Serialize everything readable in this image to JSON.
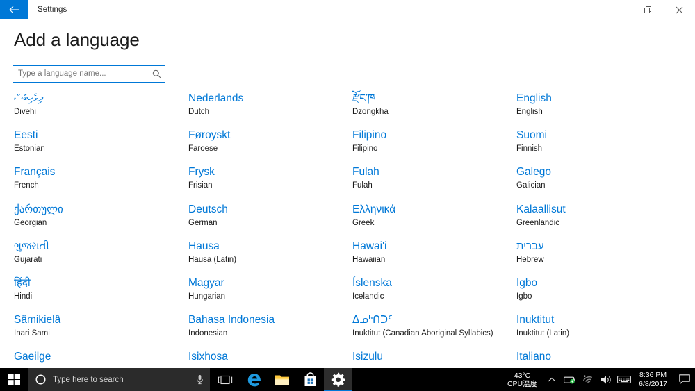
{
  "window": {
    "title": "Settings",
    "back_icon": "back-arrow-icon",
    "minimize_label": "Minimize",
    "restore_label": "Restore",
    "close_label": "Close"
  },
  "page": {
    "heading": "Add a language"
  },
  "search": {
    "placeholder": "Type a language name...",
    "value": "",
    "icon": "search-icon"
  },
  "languages": [
    [
      {
        "native": "ދިވެހިބަސް",
        "english": "Divehi",
        "script": true
      },
      {
        "native": "Nederlands",
        "english": "Dutch",
        "script": false
      },
      {
        "native": "རྫོང་ཁ",
        "english": "Dzongkha",
        "script": true
      },
      {
        "native": "English",
        "english": "English",
        "script": false
      }
    ],
    [
      {
        "native": "Eesti",
        "english": "Estonian",
        "script": false
      },
      {
        "native": "Føroyskt",
        "english": "Faroese",
        "script": false
      },
      {
        "native": "Filipino",
        "english": "Filipino",
        "script": false
      },
      {
        "native": "Suomi",
        "english": "Finnish",
        "script": false
      }
    ],
    [
      {
        "native": "Français",
        "english": "French",
        "script": false
      },
      {
        "native": "Frysk",
        "english": "Frisian",
        "script": false
      },
      {
        "native": "Fulah",
        "english": "Fulah",
        "script": false
      },
      {
        "native": "Galego",
        "english": "Galician",
        "script": false
      }
    ],
    [
      {
        "native": "ქართული",
        "english": "Georgian",
        "script": true
      },
      {
        "native": "Deutsch",
        "english": "German",
        "script": false
      },
      {
        "native": "Ελληνικά",
        "english": "Greek",
        "script": false
      },
      {
        "native": "Kalaallisut",
        "english": "Greenlandic",
        "script": false
      }
    ],
    [
      {
        "native": "ગુજરાતી",
        "english": "Gujarati",
        "script": true
      },
      {
        "native": "Hausa",
        "english": "Hausa (Latin)",
        "script": false
      },
      {
        "native": "Hawai'i",
        "english": "Hawaiian",
        "script": false
      },
      {
        "native": "עברית",
        "english": "Hebrew",
        "script": true
      }
    ],
    [
      {
        "native": "हिंदी",
        "english": "Hindi",
        "script": true
      },
      {
        "native": "Magyar",
        "english": "Hungarian",
        "script": false
      },
      {
        "native": "Íslenska",
        "english": "Icelandic",
        "script": false
      },
      {
        "native": "Igbo",
        "english": "Igbo",
        "script": false
      }
    ],
    [
      {
        "native": "Sämikielâ",
        "english": "Inari Sami",
        "script": false
      },
      {
        "native": "Bahasa Indonesia",
        "english": "Indonesian",
        "script": false
      },
      {
        "native": "ᐃᓄᒃᑎᑐᑦ",
        "english": "Inuktitut (Canadian Aboriginal Syllabics)",
        "script": true
      },
      {
        "native": "Inuktitut",
        "english": "Inuktitut (Latin)",
        "script": false
      }
    ],
    [
      {
        "native": "Gaeilge",
        "english": "",
        "script": false
      },
      {
        "native": "Isixhosa",
        "english": "",
        "script": false
      },
      {
        "native": "Isizulu",
        "english": "",
        "script": false
      },
      {
        "native": "Italiano",
        "english": "",
        "script": false
      }
    ]
  ],
  "taskbar": {
    "start_icon": "windows-start-icon",
    "cortana_icon": "cortana-circle-icon",
    "search_placeholder": "Type here to search",
    "mic_icon": "microphone-icon",
    "taskview_icon": "task-view-icon",
    "apps": [
      {
        "name": "microsoft-edge",
        "label": "Microsoft Edge",
        "active": false
      },
      {
        "name": "file-explorer",
        "label": "File Explorer",
        "active": false
      },
      {
        "name": "microsoft-store",
        "label": "Microsoft Store",
        "active": false
      },
      {
        "name": "settings",
        "label": "Settings",
        "active": true
      }
    ],
    "tray": {
      "cpu_temp": "43°C",
      "cpu_label": "CPU温度",
      "chevron_icon": "show-hidden-icons-chevron",
      "battery_icon": "battery-charging-icon",
      "wifi_icon": "wifi-icon",
      "volume_icon": "speaker-icon",
      "keyboard_icon": "touch-keyboard-icon",
      "time": "8:36 PM",
      "date": "6/8/2017",
      "action_center_icon": "action-center-icon"
    }
  },
  "colors": {
    "accent": "#0078d7",
    "taskbar_bg": "#000000",
    "text": "#1a1a1a",
    "placeholder": "#767676"
  }
}
